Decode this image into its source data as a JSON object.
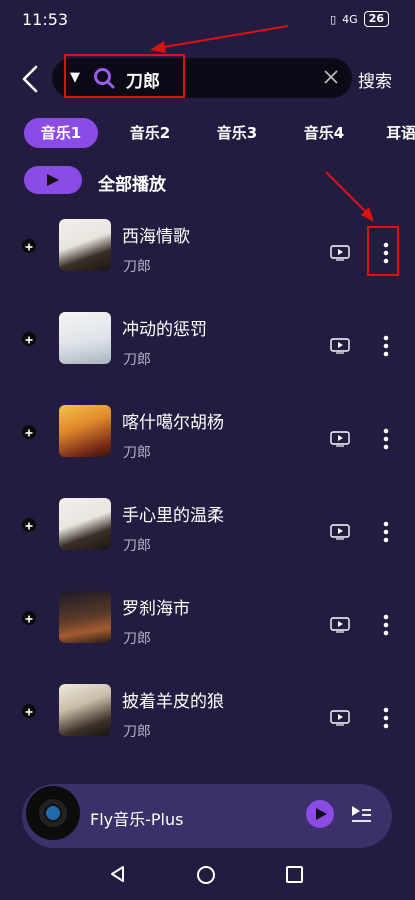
{
  "status_bar": {
    "time": "11:53",
    "signal": "4G",
    "battery": "26"
  },
  "search": {
    "query": "刀郎",
    "button_label": "搜索"
  },
  "tabs": [
    {
      "label": "音乐1",
      "active": true
    },
    {
      "label": "音乐2",
      "active": false
    },
    {
      "label": "音乐3",
      "active": false
    },
    {
      "label": "音乐4",
      "active": false
    },
    {
      "label": "耳语",
      "active": false
    }
  ],
  "play_all": {
    "label": "全部播放"
  },
  "songs": [
    {
      "title": "西海情歌",
      "artist": "刀郎"
    },
    {
      "title": "冲动的惩罚",
      "artist": "刀郎"
    },
    {
      "title": "喀什噶尔胡杨",
      "artist": "刀郎"
    },
    {
      "title": "手心里的温柔",
      "artist": "刀郎"
    },
    {
      "title": "罗刹海市",
      "artist": "刀郎"
    },
    {
      "title": "披着羊皮的狼",
      "artist": "刀郎"
    }
  ],
  "player": {
    "title": "Fly音乐-Plus"
  },
  "colors": {
    "accent": "#8b4ce6",
    "background": "#231c40",
    "highlight": "#e01010"
  }
}
